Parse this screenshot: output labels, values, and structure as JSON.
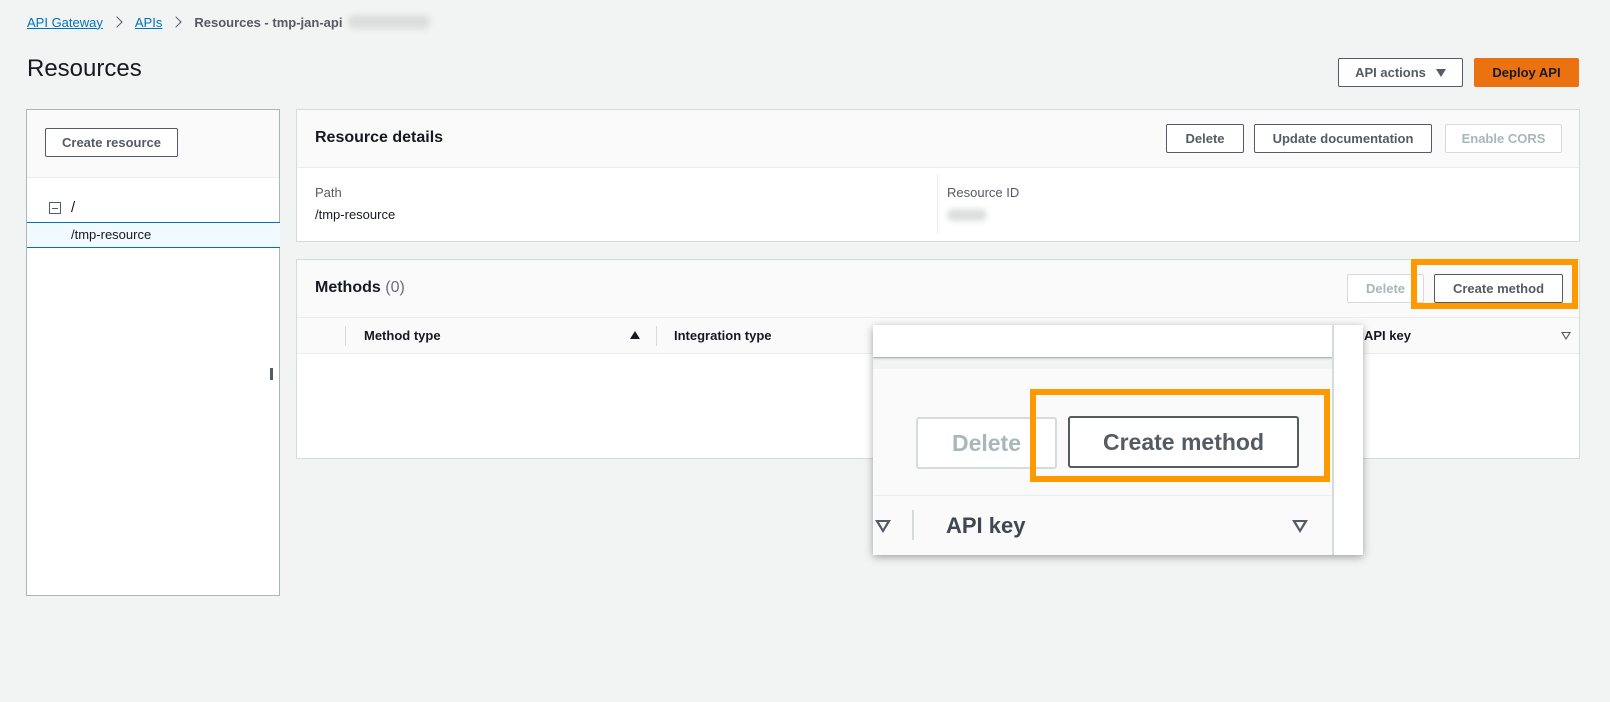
{
  "breadcrumb": {
    "items": [
      "API Gateway",
      "APIs"
    ],
    "current": "Resources - tmp-jan-api"
  },
  "page": {
    "title": "Resources"
  },
  "header_actions": {
    "api_actions": "API actions",
    "deploy_api": "Deploy API"
  },
  "resource_tree": {
    "create_resource": "Create resource",
    "root": "/",
    "child": "/tmp-resource"
  },
  "resource_details": {
    "title": "Resource details",
    "delete": "Delete",
    "update_documentation": "Update documentation",
    "enable_cors": "Enable CORS",
    "path_label": "Path",
    "path_value": "/tmp-resource",
    "resource_id_label": "Resource ID"
  },
  "methods": {
    "title": "Methods",
    "count": "(0)",
    "delete": "Delete",
    "create_method": "Create method",
    "columns": [
      "Method type",
      "Integration type",
      "API key"
    ]
  },
  "zoom": {
    "delete": "Delete",
    "create_method": "Create method",
    "api_key": "API key"
  },
  "colors": {
    "highlight": "#ff9900",
    "primary": "#ec7211",
    "link": "#0073bb"
  }
}
